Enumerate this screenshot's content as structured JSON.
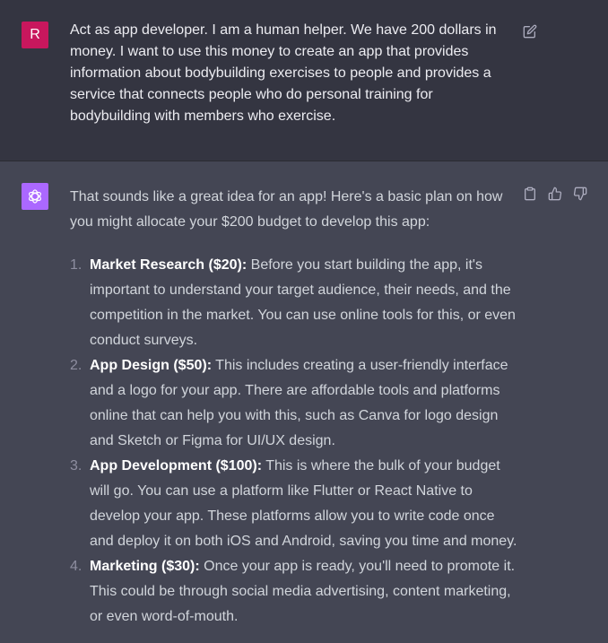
{
  "user_message": {
    "avatar_letter": "R",
    "text": "Act as app developer. I am a human helper. We have 200 dollars in money. I want to use this money to create an app that provides information about bodybuilding exercises to people and provides a service that connects people who do personal training for bodybuilding with members who exercise.",
    "edit_icon": "edit-icon"
  },
  "assistant_message": {
    "intro": "That sounds like a great idea for an app! Here's a basic plan on how you might allocate your $200 budget to develop this app:",
    "items": [
      {
        "number": "1.",
        "title": "Market Research ($20):",
        "text": " Before you start building the app, it's important to understand your target audience, their needs, and the competition in the market. You can use online tools for this, or even conduct surveys."
      },
      {
        "number": "2.",
        "title": "App Design ($50):",
        "text": " This includes creating a user-friendly interface and a logo for your app. There are affordable tools and platforms online that can help you with this, such as Canva for logo design and Sketch or Figma for UI/UX design."
      },
      {
        "number": "3.",
        "title": "App Development ($100):",
        "text": " This is where the bulk of your budget will go. You can use a platform like Flutter or React Native to develop your app. These platforms allow you to write code once and deploy it on both iOS and Android, saving you time and money."
      },
      {
        "number": "4.",
        "title": "Marketing ($30):",
        "text": " Once your app is ready, you'll need to promote it. This could be through social media advertising, content marketing, or even word-of-mouth."
      }
    ],
    "icons": [
      "copy-icon",
      "thumbs-up-icon",
      "thumbs-down-icon"
    ]
  },
  "colors": {
    "user_bg": "#343541",
    "assistant_bg": "#444654",
    "user_avatar": "#c8175d",
    "assistant_avatar": "#ab68ff"
  }
}
